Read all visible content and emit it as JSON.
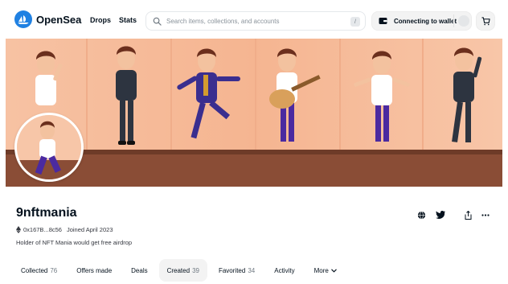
{
  "header": {
    "brand": "OpenSea",
    "nav": [
      "Drops",
      "Stats"
    ],
    "search_placeholder": "Search items, collections, and accounts",
    "search_shortcut": "/",
    "wallet_label": "Connecting to wallet"
  },
  "icons": {
    "logo": "opensea-logo-icon",
    "search": "search-icon",
    "wallet": "wallet-icon",
    "cart": "cart-icon",
    "globe": "globe-icon",
    "twitter": "twitter-icon",
    "share": "share-icon",
    "more": "more-icon",
    "eth": "eth-icon"
  },
  "profile": {
    "name": "9nftmania",
    "address": "0x167B...8c56",
    "joined": "Joined April 2023",
    "bio": "Holder of NFT Mania would get free airdrop"
  },
  "tabs": [
    {
      "label": "Collected",
      "count": "76",
      "active": false
    },
    {
      "label": "Offers made",
      "count": "",
      "active": false
    },
    {
      "label": "Deals",
      "count": "",
      "active": false
    },
    {
      "label": "Created",
      "count": "39",
      "active": true
    },
    {
      "label": "Favorited",
      "count": "34",
      "active": false
    },
    {
      "label": "Activity",
      "count": "",
      "active": false
    },
    {
      "label": "More",
      "count": "",
      "active": false
    }
  ],
  "colors": {
    "brand": "#2081e2",
    "banner_wall": "#f6b896",
    "banner_floor": "#8a4d36",
    "text": "#04111d",
    "muted": "#707a83"
  }
}
